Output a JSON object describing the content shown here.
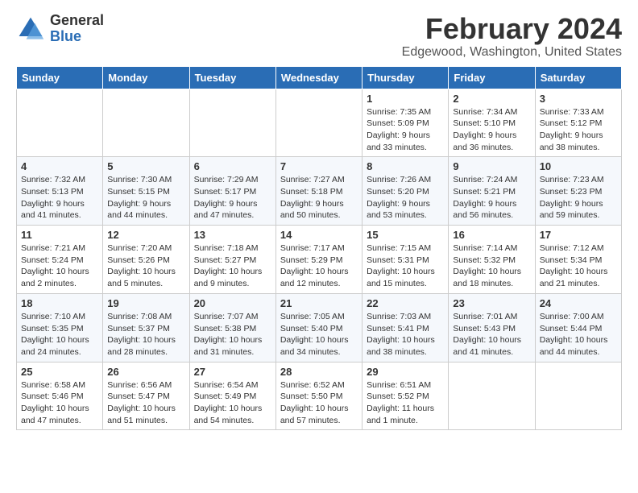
{
  "logo": {
    "general": "General",
    "blue": "Blue"
  },
  "header": {
    "month_year": "February 2024",
    "location": "Edgewood, Washington, United States"
  },
  "days_of_week": [
    "Sunday",
    "Monday",
    "Tuesday",
    "Wednesday",
    "Thursday",
    "Friday",
    "Saturday"
  ],
  "weeks": [
    [
      {
        "day": "",
        "info": ""
      },
      {
        "day": "",
        "info": ""
      },
      {
        "day": "",
        "info": ""
      },
      {
        "day": "",
        "info": ""
      },
      {
        "day": "1",
        "info": "Sunrise: 7:35 AM\nSunset: 5:09 PM\nDaylight: 9 hours and 33 minutes."
      },
      {
        "day": "2",
        "info": "Sunrise: 7:34 AM\nSunset: 5:10 PM\nDaylight: 9 hours and 36 minutes."
      },
      {
        "day": "3",
        "info": "Sunrise: 7:33 AM\nSunset: 5:12 PM\nDaylight: 9 hours and 38 minutes."
      }
    ],
    [
      {
        "day": "4",
        "info": "Sunrise: 7:32 AM\nSunset: 5:13 PM\nDaylight: 9 hours and 41 minutes."
      },
      {
        "day": "5",
        "info": "Sunrise: 7:30 AM\nSunset: 5:15 PM\nDaylight: 9 hours and 44 minutes."
      },
      {
        "day": "6",
        "info": "Sunrise: 7:29 AM\nSunset: 5:17 PM\nDaylight: 9 hours and 47 minutes."
      },
      {
        "day": "7",
        "info": "Sunrise: 7:27 AM\nSunset: 5:18 PM\nDaylight: 9 hours and 50 minutes."
      },
      {
        "day": "8",
        "info": "Sunrise: 7:26 AM\nSunset: 5:20 PM\nDaylight: 9 hours and 53 minutes."
      },
      {
        "day": "9",
        "info": "Sunrise: 7:24 AM\nSunset: 5:21 PM\nDaylight: 9 hours and 56 minutes."
      },
      {
        "day": "10",
        "info": "Sunrise: 7:23 AM\nSunset: 5:23 PM\nDaylight: 9 hours and 59 minutes."
      }
    ],
    [
      {
        "day": "11",
        "info": "Sunrise: 7:21 AM\nSunset: 5:24 PM\nDaylight: 10 hours and 2 minutes."
      },
      {
        "day": "12",
        "info": "Sunrise: 7:20 AM\nSunset: 5:26 PM\nDaylight: 10 hours and 5 minutes."
      },
      {
        "day": "13",
        "info": "Sunrise: 7:18 AM\nSunset: 5:27 PM\nDaylight: 10 hours and 9 minutes."
      },
      {
        "day": "14",
        "info": "Sunrise: 7:17 AM\nSunset: 5:29 PM\nDaylight: 10 hours and 12 minutes."
      },
      {
        "day": "15",
        "info": "Sunrise: 7:15 AM\nSunset: 5:31 PM\nDaylight: 10 hours and 15 minutes."
      },
      {
        "day": "16",
        "info": "Sunrise: 7:14 AM\nSunset: 5:32 PM\nDaylight: 10 hours and 18 minutes."
      },
      {
        "day": "17",
        "info": "Sunrise: 7:12 AM\nSunset: 5:34 PM\nDaylight: 10 hours and 21 minutes."
      }
    ],
    [
      {
        "day": "18",
        "info": "Sunrise: 7:10 AM\nSunset: 5:35 PM\nDaylight: 10 hours and 24 minutes."
      },
      {
        "day": "19",
        "info": "Sunrise: 7:08 AM\nSunset: 5:37 PM\nDaylight: 10 hours and 28 minutes."
      },
      {
        "day": "20",
        "info": "Sunrise: 7:07 AM\nSunset: 5:38 PM\nDaylight: 10 hours and 31 minutes."
      },
      {
        "day": "21",
        "info": "Sunrise: 7:05 AM\nSunset: 5:40 PM\nDaylight: 10 hours and 34 minutes."
      },
      {
        "day": "22",
        "info": "Sunrise: 7:03 AM\nSunset: 5:41 PM\nDaylight: 10 hours and 38 minutes."
      },
      {
        "day": "23",
        "info": "Sunrise: 7:01 AM\nSunset: 5:43 PM\nDaylight: 10 hours and 41 minutes."
      },
      {
        "day": "24",
        "info": "Sunrise: 7:00 AM\nSunset: 5:44 PM\nDaylight: 10 hours and 44 minutes."
      }
    ],
    [
      {
        "day": "25",
        "info": "Sunrise: 6:58 AM\nSunset: 5:46 PM\nDaylight: 10 hours and 47 minutes."
      },
      {
        "day": "26",
        "info": "Sunrise: 6:56 AM\nSunset: 5:47 PM\nDaylight: 10 hours and 51 minutes."
      },
      {
        "day": "27",
        "info": "Sunrise: 6:54 AM\nSunset: 5:49 PM\nDaylight: 10 hours and 54 minutes."
      },
      {
        "day": "28",
        "info": "Sunrise: 6:52 AM\nSunset: 5:50 PM\nDaylight: 10 hours and 57 minutes."
      },
      {
        "day": "29",
        "info": "Sunrise: 6:51 AM\nSunset: 5:52 PM\nDaylight: 11 hours and 1 minute."
      },
      {
        "day": "",
        "info": ""
      },
      {
        "day": "",
        "info": ""
      }
    ]
  ]
}
